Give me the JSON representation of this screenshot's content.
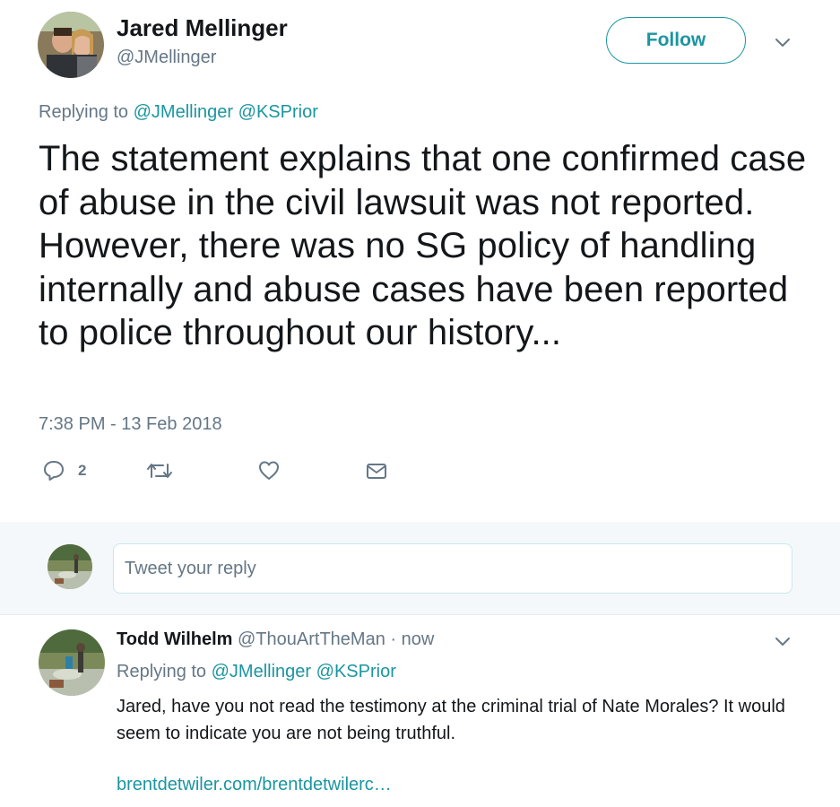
{
  "tweet": {
    "author_name": "Jared Mellinger",
    "author_handle": "@JMellinger",
    "follow_label": "Follow",
    "replying_prefix": "Replying to",
    "replying_handles": [
      "@JMellinger",
      "@KSPrior"
    ],
    "text": "The statement explains that one confirmed case of abuse in the civil lawsuit was not reported. However, there was no SG policy of handling internally and abuse cases have been reported to police throughout our history...",
    "timestamp": "7:38 PM - 13 Feb 2018",
    "actions": {
      "reply_icon": "reply-icon",
      "reply_count": "2",
      "retweet_icon": "retweet-icon",
      "like_icon": "heart-icon",
      "dm_icon": "envelope-icon"
    }
  },
  "composer": {
    "placeholder": "Tweet your reply"
  },
  "reply": {
    "author_name": "Todd Wilhelm",
    "author_handle": "@ThouArtTheMan",
    "separator": "·",
    "time": "now",
    "replying_prefix": "Replying to",
    "replying_handles": [
      "@JMellinger",
      "@KSPrior"
    ],
    "text": "Jared, have you not read the testimony at the criminal trial of Nate Morales? It would seem to indicate you are not being truthful.",
    "link": "brentdetwiler.com/brentdetwilerc…"
  },
  "colors": {
    "accent": "#1b95a0",
    "secondary_text": "#657786",
    "primary_text": "#14171a",
    "composer_bg": "#f5f8fa"
  }
}
